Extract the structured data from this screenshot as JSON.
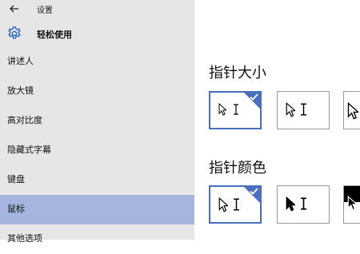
{
  "header": {
    "back_icon": "back-arrow-icon",
    "title": "设置"
  },
  "section": {
    "icon": "gear-icon",
    "title": "轻松使用",
    "accent": "#2a62c6"
  },
  "sidebar": {
    "items": [
      {
        "label": "讲述人",
        "selected": false
      },
      {
        "label": "放大镜",
        "selected": false
      },
      {
        "label": "高对比度",
        "selected": false
      },
      {
        "label": "隐藏式字幕",
        "selected": false
      },
      {
        "label": "键盘",
        "selected": false
      },
      {
        "label": "鼠标",
        "selected": true
      },
      {
        "label": "其他选项",
        "selected": false
      }
    ],
    "selected_color": "#a6b4e0"
  },
  "main": {
    "pointer_size": {
      "heading": "指针大小",
      "options": [
        {
          "size": "small",
          "selected": true
        },
        {
          "size": "medium",
          "selected": false
        },
        {
          "size": "large",
          "selected": false
        }
      ]
    },
    "pointer_color": {
      "heading": "指针颜色",
      "options": [
        {
          "scheme": "white",
          "selected": true
        },
        {
          "scheme": "black",
          "selected": false
        },
        {
          "scheme": "inverted",
          "selected": false
        }
      ]
    },
    "selection_color": "#4a6fbf"
  }
}
